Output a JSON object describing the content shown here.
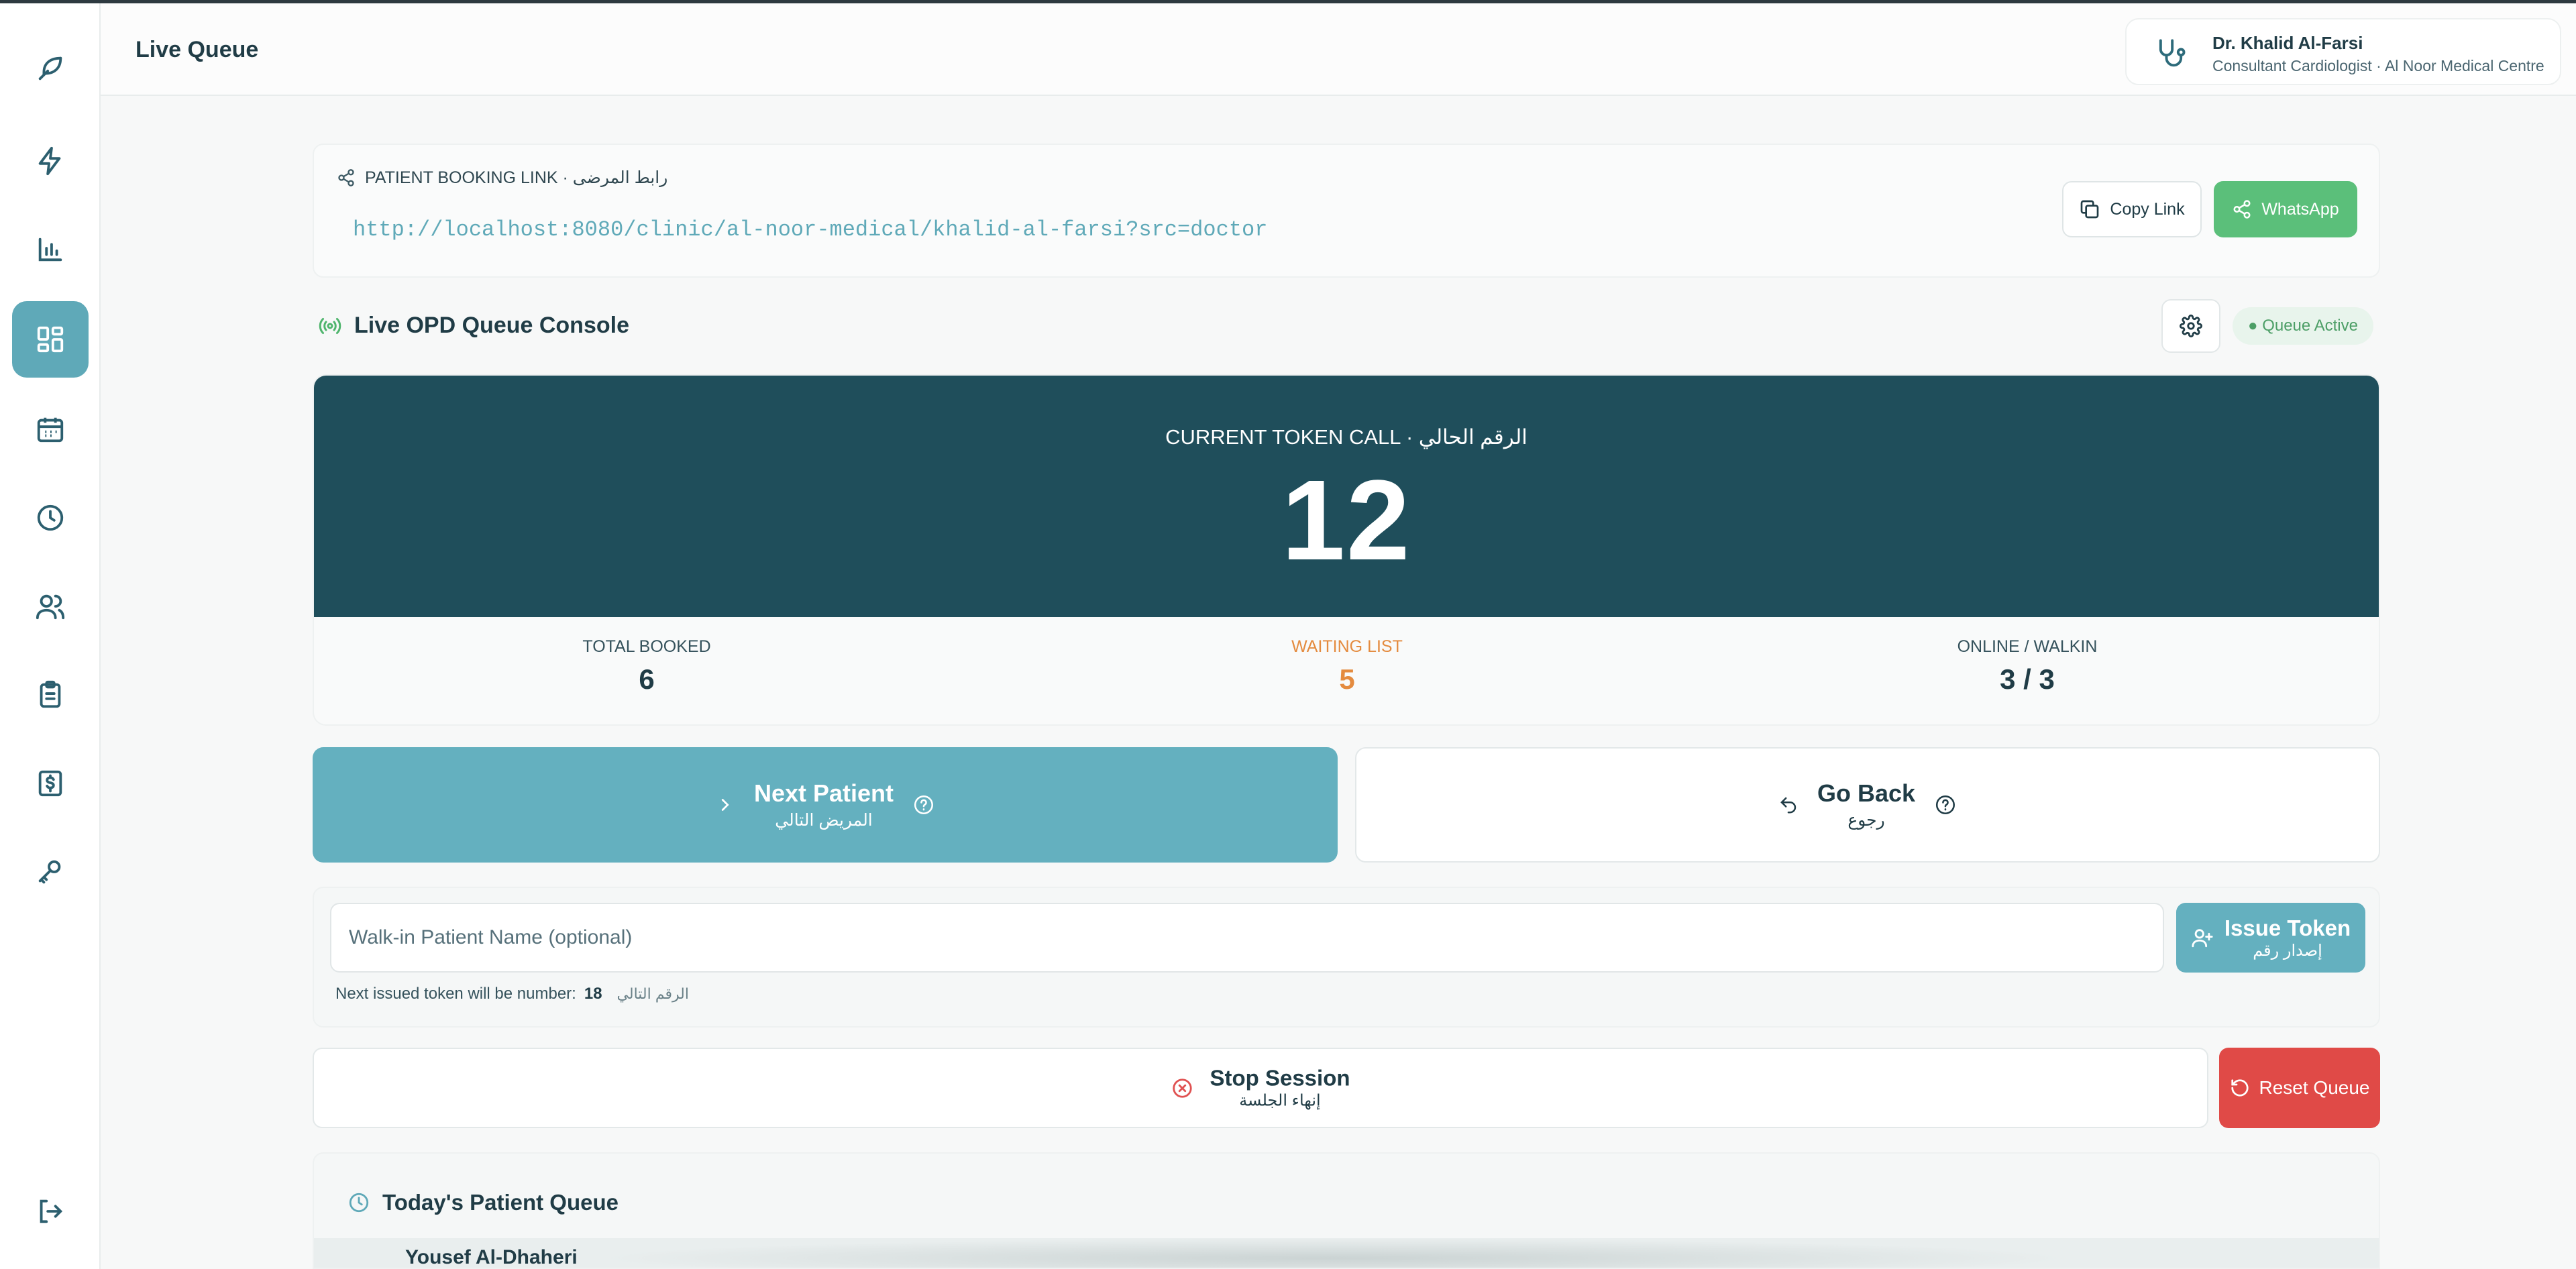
{
  "header": {
    "title": "Live Queue",
    "doctor_name": "Dr. Khalid Al-Farsi",
    "doctor_role": "Consultant Cardiologist · Al Noor Medical Centre"
  },
  "sidebar": {
    "items": [
      {
        "icon": "logo-leaf-icon"
      },
      {
        "icon": "lightning-icon"
      },
      {
        "icon": "bar-chart-icon"
      },
      {
        "icon": "dashboard-grid-icon",
        "active": true
      },
      {
        "icon": "calendar-icon"
      },
      {
        "icon": "clock-icon"
      },
      {
        "icon": "users-icon"
      },
      {
        "icon": "clipboard-icon"
      },
      {
        "icon": "billing-icon"
      },
      {
        "icon": "key-icon"
      },
      {
        "icon": "logout-icon"
      }
    ]
  },
  "booking": {
    "label": "PATIENT BOOKING LINK · رابط المرضى",
    "url": "http://localhost:8080/clinic/al-noor-medical/khalid-al-farsi?src=doctor",
    "copy_label": "Copy Link",
    "whatsapp_label": "WhatsApp"
  },
  "console": {
    "title": "Live OPD Queue Console",
    "status_badge": "● Queue Active"
  },
  "token": {
    "label": "CURRENT TOKEN CALL · الرقم الحالي",
    "number": "12"
  },
  "stats": {
    "total_booked_label": "TOTAL BOOKED",
    "total_booked_value": "6",
    "waiting_label": "WAITING LIST",
    "waiting_value": "5",
    "online_walkin_label": "ONLINE / WALKIN",
    "online_walkin_value": "3 / 3"
  },
  "actions": {
    "next_label": "Next Patient",
    "next_sub": "المريض التالي",
    "back_label": "Go Back",
    "back_sub": "رجوع"
  },
  "walkin": {
    "placeholder": "Walk-in Patient Name (optional)",
    "issue_label": "Issue Token",
    "issue_sub": "إصدار رقم",
    "next_note": "Next issued token will be number:",
    "next_number": "18",
    "next_note_ar": "الرقم التالي"
  },
  "session": {
    "stop_label": "Stop Session",
    "stop_sub": "إنهاء الجلسة",
    "reset_label": "Reset Queue"
  },
  "today": {
    "title": "Today's Patient Queue",
    "first_patient": "Yousef Al-Dhaheri"
  },
  "colors": {
    "accent": "#64b0bf",
    "token_bg": "#1f4e5b",
    "whatsapp": "#5bbf7a",
    "danger": "#e04a47",
    "warning": "#e48b3f"
  }
}
